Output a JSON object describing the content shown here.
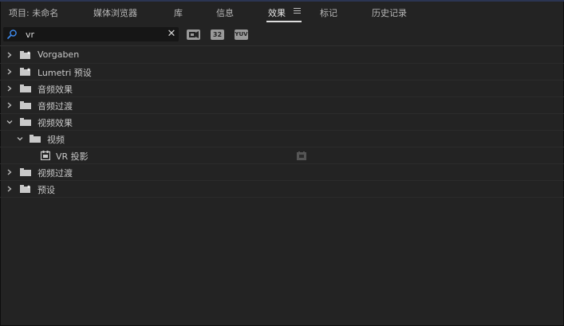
{
  "tabs": [
    {
      "label": "项目: 未命名"
    },
    {
      "label": "媒体浏览器"
    },
    {
      "label": "库"
    },
    {
      "label": "信息"
    },
    {
      "label": "效果"
    },
    {
      "label": "标记"
    },
    {
      "label": "历史记录"
    }
  ],
  "active_tab": "效果",
  "search": {
    "value": "vr",
    "placeholder": ""
  },
  "filters": [
    {
      "name": "accelerated-effects",
      "label": ""
    },
    {
      "name": "32-bit-color",
      "label": "32"
    },
    {
      "name": "yuv-effects",
      "label": "YUV"
    }
  ],
  "tree": [
    {
      "label": "Vorgaben",
      "type": "preset-folder",
      "expanded": false
    },
    {
      "label": "Lumetri 预设",
      "type": "preset-folder",
      "expanded": false
    },
    {
      "label": "音频效果",
      "type": "folder",
      "expanded": false
    },
    {
      "label": "音频过渡",
      "type": "folder",
      "expanded": false
    },
    {
      "label": "视频效果",
      "type": "folder",
      "expanded": true
    },
    {
      "label": "视频",
      "type": "folder",
      "expanded": true
    },
    {
      "label": "VR 投影",
      "type": "effect",
      "accelerated": true
    },
    {
      "label": "视频过渡",
      "type": "folder",
      "expanded": false
    },
    {
      "label": "预设",
      "type": "preset-folder",
      "expanded": false
    }
  ],
  "colors": {
    "background": "#232323",
    "text": "#c8c8c8",
    "accent_line": "#2b3552"
  }
}
